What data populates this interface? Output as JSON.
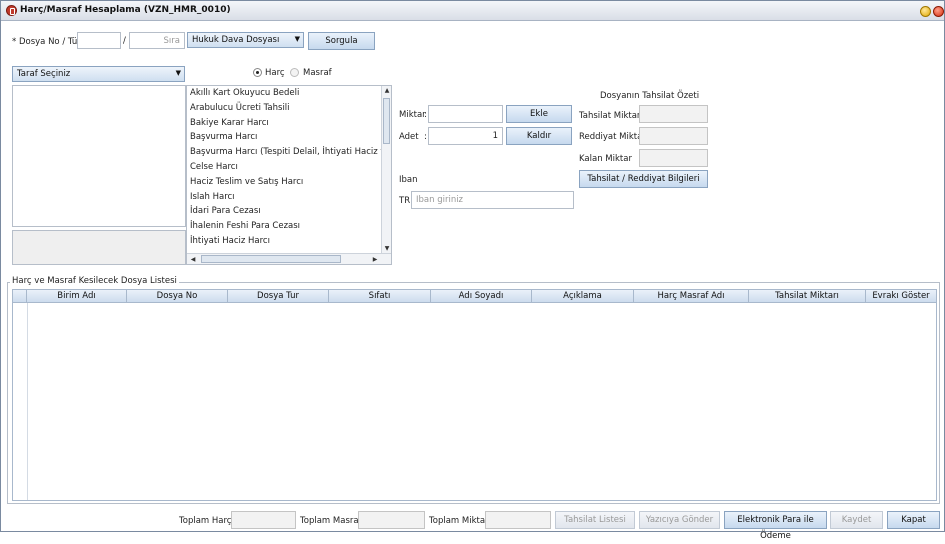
{
  "window": {
    "title": "Harç/Masraf Hesaplama (VZN_HMR_0010)"
  },
  "query": {
    "dosya_label": "* Dosya No / Tür",
    "slash": "/",
    "sira_label": "Sıra",
    "dosya_turu": "Hukuk Dava Dosyası",
    "sorgula": "Sorgula"
  },
  "taraf": {
    "placeholder": "Taraf Seçiniz"
  },
  "type_radio": {
    "harc": "Harç",
    "masraf": "Masraf",
    "selected": "harc"
  },
  "items": [
    "Akıllı Kart Okuyucu Bedeli",
    "Arabulucu Ücreti Tahsili",
    "Bakiye Karar Harcı",
    "Başvurma Harcı",
    "Başvurma Harcı (Tespiti Delail, İhtiyati Haciz ve İhtiyati",
    "Celse Harcı",
    "Haciz Teslim ve Satış Harcı",
    "Islah Harcı",
    "İdari Para Cezası",
    "İhalenin Feshi Para Cezası",
    "İhtiyati Haciz Harcı"
  ],
  "entry": {
    "miktar_label": "Miktar",
    "adet_label": "Adet",
    "colon": ":",
    "adet_value": "1",
    "ekle": "Ekle",
    "kaldir": "Kaldır",
    "iban_label": "Iban",
    "tr_prefix": "TR",
    "iban_placeholder": "Iban giriniz"
  },
  "ozet": {
    "title": "Dosyanın Tahsilat Özeti",
    "tahsilat_miktari": "Tahsilat Miktarı",
    "reddiyat_miktari": "Reddiyat Miktarı",
    "kalan_miktar": "Kalan Miktar",
    "bilgiler_button": "Tahsilat / Reddiyat Bilgileri"
  },
  "list": {
    "title": "Harç ve Masraf Kesilecek Dosya Listesi",
    "columns": [
      "Birim Adı",
      "Dosya No",
      "Dosya Tur",
      "Sıfatı",
      "Adı Soyadı",
      "Açıklama",
      "Harç Masraf Adı",
      "Tahsilat Miktarı",
      "Evrakı Göster"
    ]
  },
  "footer": {
    "toplam_harc": "Toplam Harç",
    "toplam_masraf": "Toplam Masraf",
    "toplam_miktar": "Toplam Miktar",
    "tahsilat_listesi": "Tahsilat Listesi",
    "yaziciya_gonder": "Yazıcıya Gönder",
    "elektronik_odeme": "Elektronik Para ile Ödeme",
    "kaydet": "Kaydet",
    "kapat": "Kapat"
  }
}
